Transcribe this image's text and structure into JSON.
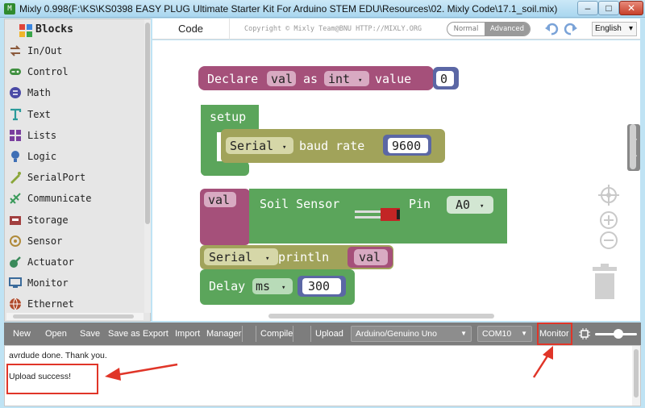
{
  "window": {
    "title": "Mixly 0.998(F:\\KS\\KS0398 EASY PLUG Ultimate Starter Kit For Arduino STEM EDU\\Resources\\02. Mixly Code\\17.1_soil.mix)",
    "app_icon": "M",
    "minimize": "–",
    "maximize": "□",
    "close": "✕"
  },
  "sidebar": {
    "header": "Blocks",
    "categories": [
      {
        "label": "In/Out",
        "icon": "in-out-icon",
        "color": "#8b5a3c"
      },
      {
        "label": "Control",
        "icon": "gamepad-icon",
        "color": "#3f8f3f"
      },
      {
        "label": "Math",
        "icon": "math-icon",
        "color": "#4a4aa6"
      },
      {
        "label": "Text",
        "icon": "text-icon",
        "color": "#2a9a9a"
      },
      {
        "label": "Lists",
        "icon": "lists-icon",
        "color": "#7a3f9e"
      },
      {
        "label": "Logic",
        "icon": "bulb-icon",
        "color": "#3f6fb5"
      },
      {
        "label": "SerialPort",
        "icon": "serial-icon",
        "color": "#8aa63a"
      },
      {
        "label": "Communicate",
        "icon": "communicate-icon",
        "color": "#3a9a5a"
      },
      {
        "label": "Storage",
        "icon": "storage-icon",
        "color": "#a23f3f"
      },
      {
        "label": "Sensor",
        "icon": "sensor-icon",
        "color": "#b08a3a"
      },
      {
        "label": "Actuator",
        "icon": "actuator-icon",
        "color": "#3a8a5a"
      },
      {
        "label": "Monitor",
        "icon": "monitor-icon",
        "color": "#3a6a9a"
      },
      {
        "label": "Ethernet",
        "icon": "globe-icon",
        "color": "#b04a2a"
      }
    ]
  },
  "editor": {
    "tab_label": "Code",
    "copyright": "Copyright © Mixly Team@BNU HTTP://MIXLY.ORG",
    "mode_normal": "Normal",
    "mode_advanced": "Advanced",
    "language": "English",
    "language_caret": "▾"
  },
  "blocks": {
    "declare": {
      "label": "Declare",
      "var": "val",
      "as": "as",
      "type": "int",
      "caret": "▾",
      "value_label": "value",
      "value": "0"
    },
    "setup": {
      "label": "setup",
      "serial": "Serial",
      "caret": "▾",
      "baud_label": "baud rate",
      "baud": "9600"
    },
    "sensor": {
      "var": "val",
      "label": "Soil Sensor",
      "pin_label": "Pin",
      "pin": "A0",
      "caret": "▾"
    },
    "println": {
      "serial": "Serial",
      "caret": "▾",
      "label": "println",
      "arg": "val"
    },
    "delay": {
      "label": "Delay",
      "unit": "ms",
      "caret": "▾",
      "value": "300"
    }
  },
  "toolbar": {
    "new": "New",
    "open": "Open",
    "save": "Save",
    "save_as": "Save as",
    "export": "Export",
    "import": "Import",
    "manager": "Manager",
    "compile": "Compile",
    "upload": "Upload",
    "board": "Arduino/Genuino Uno",
    "port": "COM10",
    "select_caret": "▼",
    "monitor": "Monitor"
  },
  "console": {
    "line1": "avrdude done.  Thank you.",
    "line2": "Upload success!"
  },
  "colors": {
    "annotation_red": "#e03528",
    "variable_block": "#a5507a",
    "serial_block": "#a1a35a",
    "sensor_block": "#5ba55b",
    "math_block": "#5b67a5"
  }
}
